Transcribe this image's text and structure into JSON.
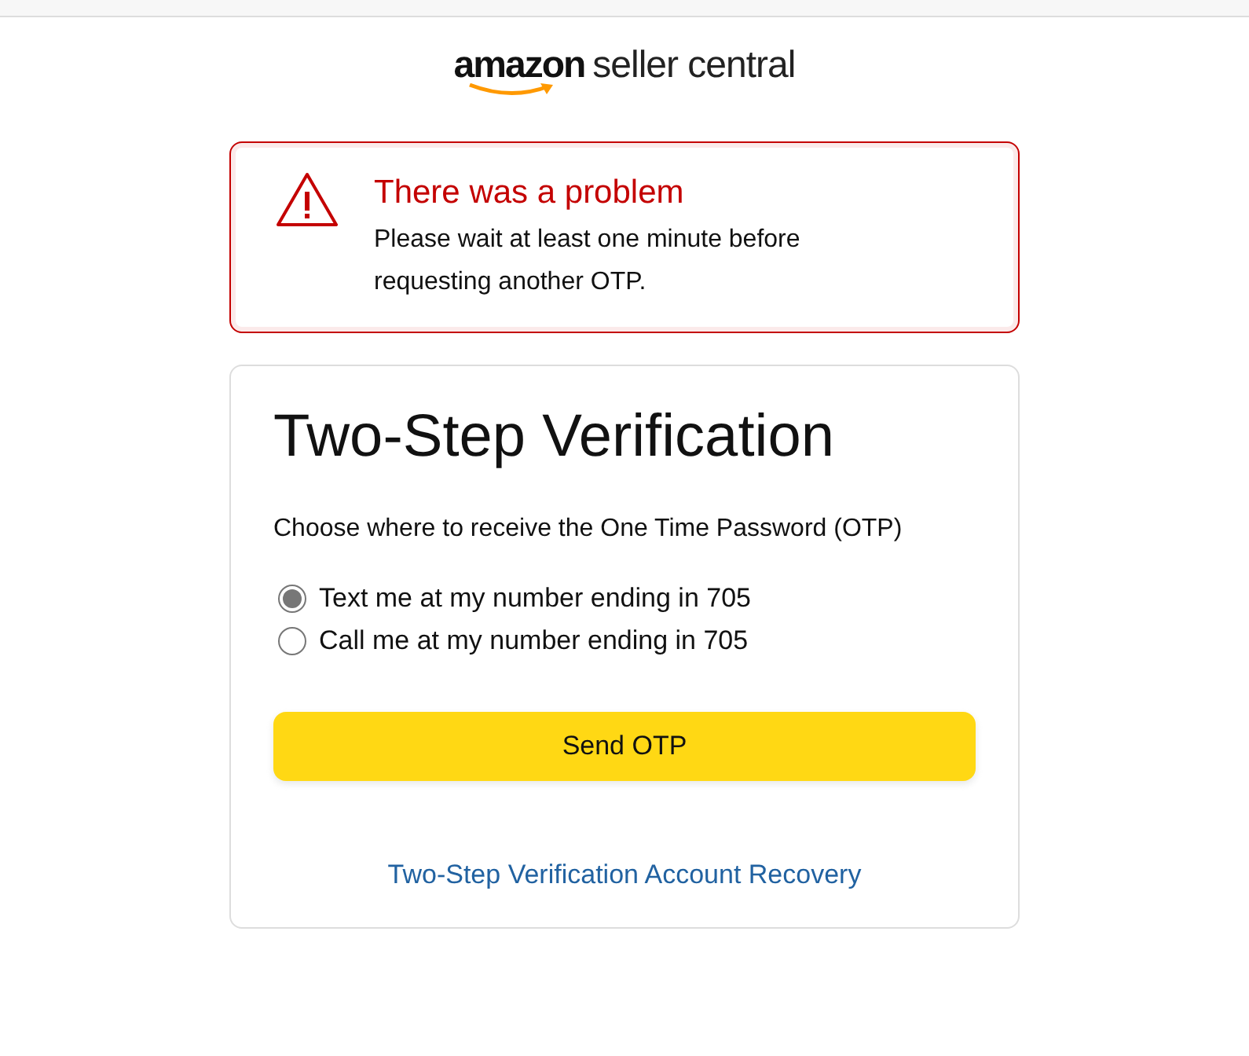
{
  "logo": {
    "brand": "amazon",
    "product": "seller central"
  },
  "alert": {
    "title": "There was a problem",
    "message": "Please wait at least one minute before requesting another OTP."
  },
  "card": {
    "title": "Two-Step Verification",
    "prompt": "Choose where to receive the One Time Password (OTP)",
    "options": [
      {
        "label": "Text me at my number ending in 705",
        "selected": true
      },
      {
        "label": "Call me at my number ending in 705",
        "selected": false
      }
    ],
    "button": "Send OTP",
    "link": "Two-Step Verification Account Recovery"
  }
}
